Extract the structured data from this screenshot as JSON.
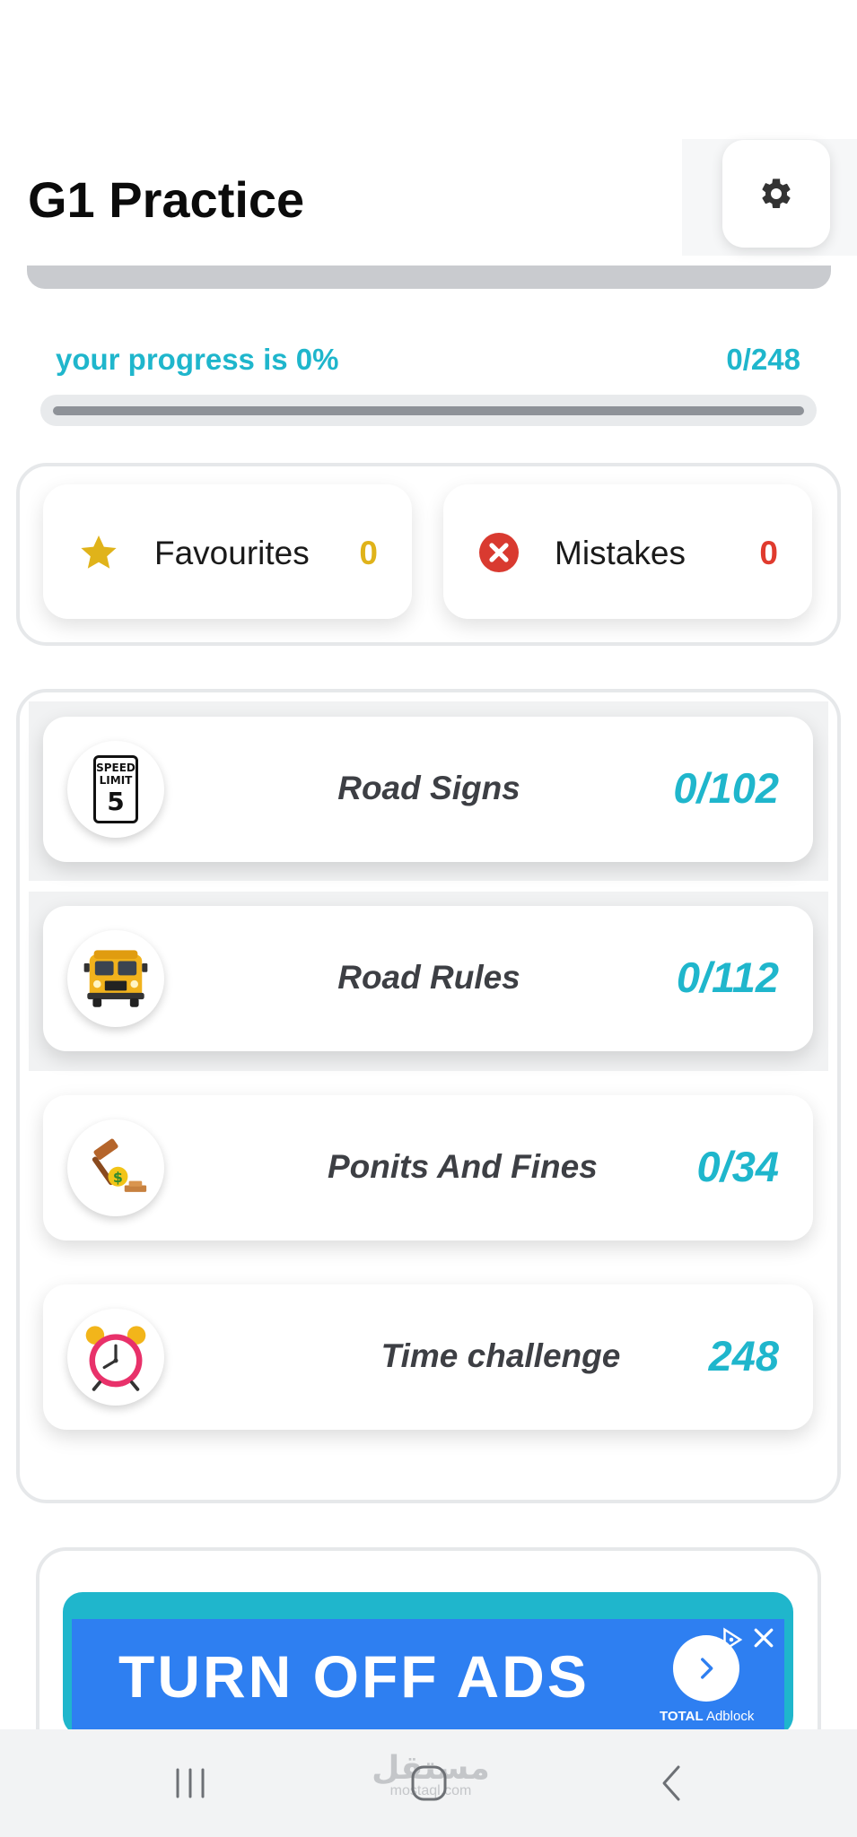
{
  "header": {
    "title": "G1 Practice",
    "settings_icon": "gear-icon"
  },
  "progress": {
    "label": "your progress is 0%",
    "count": "0/248",
    "percent": 0,
    "accent_color": "#1fb6cc"
  },
  "quick_cards": {
    "favourites": {
      "label": "Favourites",
      "count": "0",
      "icon": "star-icon",
      "color": "#e0b31a"
    },
    "mistakes": {
      "label": "Mistakes",
      "count": "0",
      "icon": "x-circle-icon",
      "color": "#e03b2e"
    }
  },
  "categories": [
    {
      "title": "Road Signs",
      "count": "0/102",
      "icon": "speed-limit-sign-icon"
    },
    {
      "title": "Road Rules",
      "count": "0/112",
      "icon": "school-bus-icon"
    },
    {
      "title": "Ponits And Fines",
      "count": "0/34",
      "icon": "gavel-money-icon"
    },
    {
      "title": "Time challenge",
      "count": "248",
      "icon": "alarm-clock-icon"
    }
  ],
  "speed_sign": {
    "line1": "SPEED",
    "line2": "LIMIT",
    "value": "5"
  },
  "ad": {
    "text": "TURN OFF ADS",
    "brand_bold": "TOTAL",
    "brand_rest": "Adblock",
    "banner_color": "#2e7ff1"
  },
  "nav": {
    "recent_icon": "recent-apps-icon",
    "home_icon": "home-icon",
    "back_icon": "back-icon",
    "watermark_ar": "مستقل",
    "watermark_en": "mostaql.com"
  }
}
